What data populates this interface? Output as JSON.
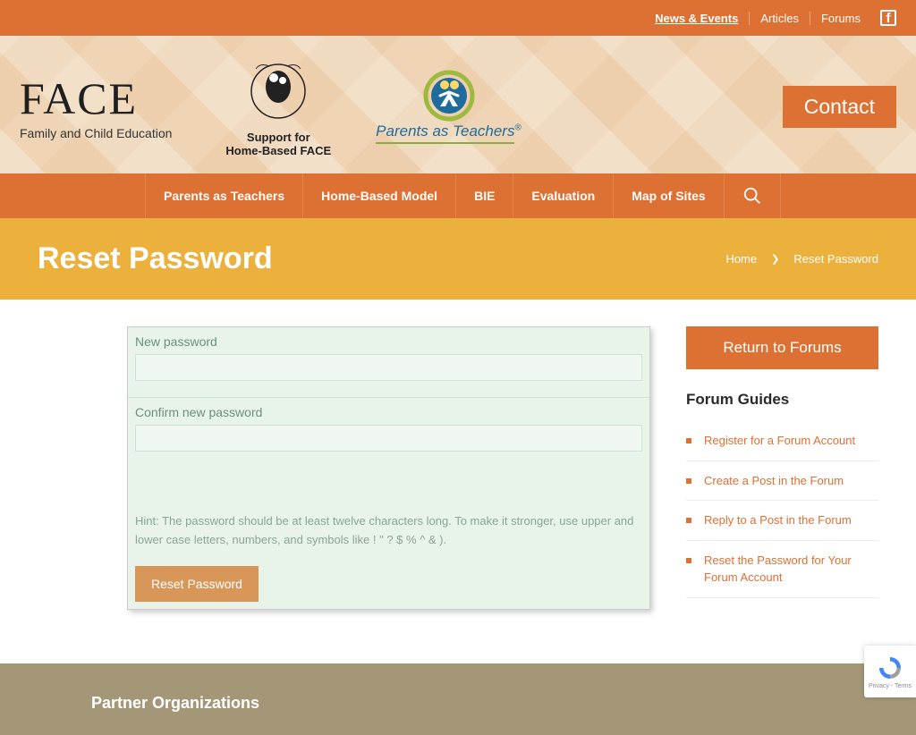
{
  "topbar": {
    "news": "News & Events",
    "articles": "Articles",
    "forums": "Forums"
  },
  "logos": {
    "face_big": "FACE",
    "face_sub": "Family and Child Education",
    "support1": "Support for",
    "support2": "Home-Based FACE",
    "pat_text": "Parents as Teachers"
  },
  "contact_label": "Contact",
  "nav": {
    "items": [
      "Parents as Teachers",
      "Home-Based Model",
      "BIE",
      "Evaluation",
      "Map of Sites"
    ]
  },
  "page_title": "Reset Password",
  "breadcrumb": {
    "home": "Home",
    "current": "Reset Password"
  },
  "form": {
    "label_new": "New password",
    "label_confirm": "Confirm new password",
    "hint": "Hint: The password should be at least twelve characters long. To make it stronger, use upper and lower case letters, numbers, and symbols like ! \" ? $ % ^ & ).",
    "submit": "Reset Password"
  },
  "sidebar": {
    "return_label": "Return to Forums",
    "guides_title": "Forum Guides",
    "guides": [
      "Register for a Forum Account",
      "Create a Post in the Forum",
      "Reply to a Post in the Forum",
      "Reset the Password for Your Forum Account"
    ]
  },
  "footer": {
    "partner": "Partner Organizations"
  },
  "recaptcha": {
    "text": "Privacy - Terms"
  }
}
